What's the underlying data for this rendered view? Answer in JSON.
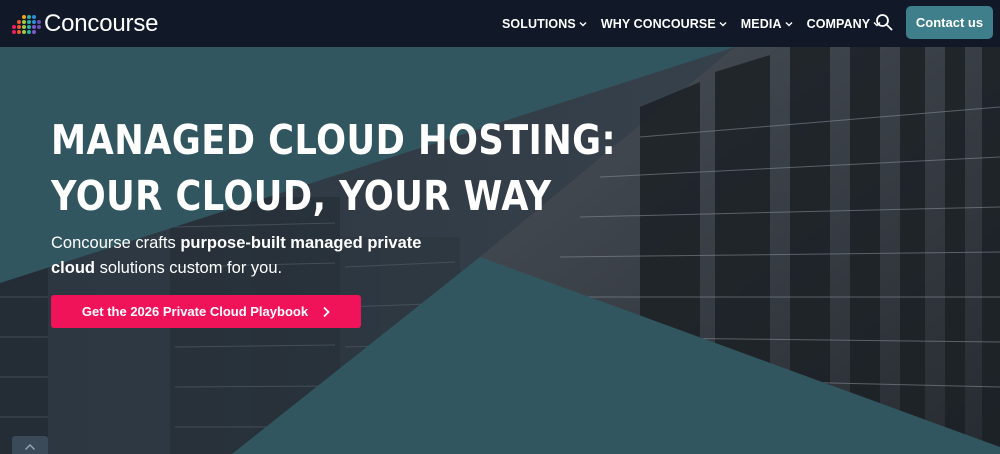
{
  "header": {
    "logo_text": "Concourse",
    "nav": [
      {
        "label": "SOLUTIONS"
      },
      {
        "label": "WHY CONCOURSE"
      },
      {
        "label": "MEDIA"
      },
      {
        "label": "COMPANY"
      }
    ],
    "contact_label": "Contact us"
  },
  "hero": {
    "headline_line1": "MANAGED CLOUD HOSTING:",
    "headline_line2": "YOUR CLOUD, YOUR WAY",
    "sub_prefix": "Concourse crafts ",
    "sub_bold": "purpose-built managed private cloud",
    "sub_suffix": " solutions custom for you.",
    "cta_label": "Get the 2026 Private Cloud Playbook"
  },
  "colors": {
    "header_bg": "#111827",
    "teal_panel": "#315660",
    "contact_button": "#3f7f8c",
    "cta_button": "#f0135a"
  },
  "icons": [
    "logo-dots-icon",
    "chevron-down-icon",
    "search-icon",
    "chevron-right-icon",
    "chevron-up-icon"
  ]
}
